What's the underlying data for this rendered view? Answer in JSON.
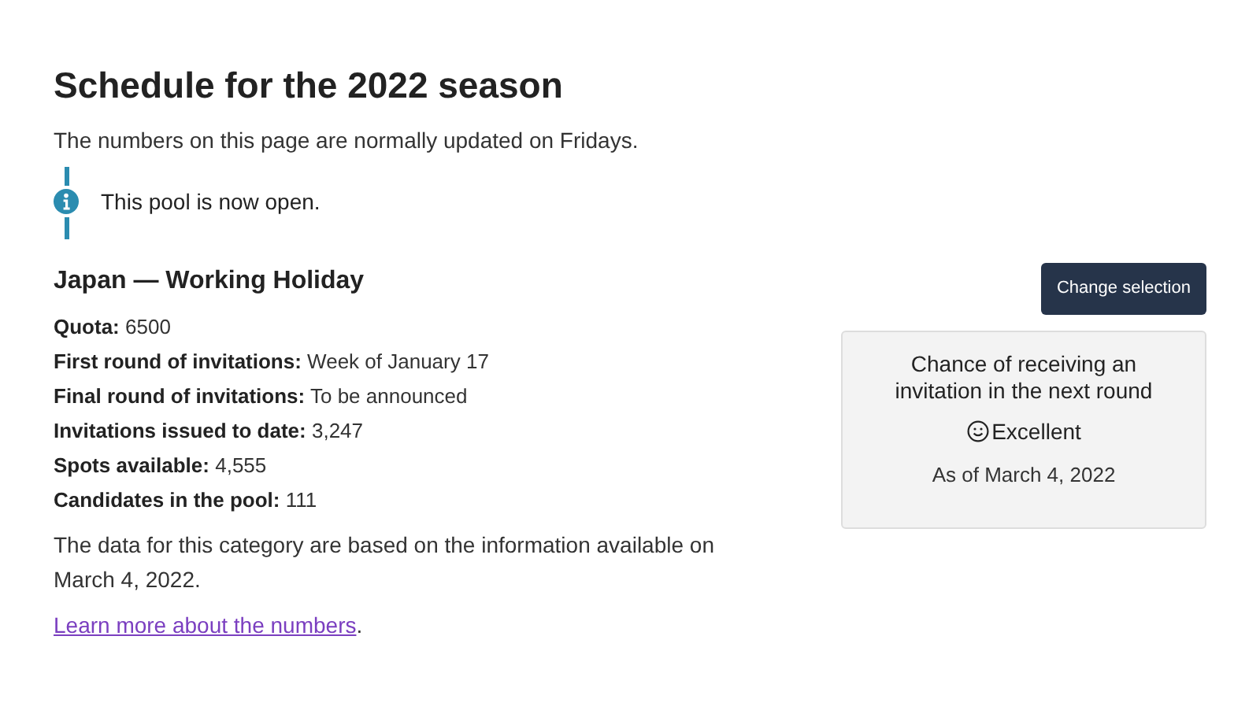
{
  "heading": "Schedule for the 2022 season",
  "intro": "The numbers on this page are normally updated on Fridays.",
  "notice": {
    "text": "This pool is now open."
  },
  "category": {
    "title": "Japan — Working Holiday"
  },
  "facts": [
    {
      "text": "**Quota:** 6500"
    },
    {
      "text": "**First round of invitations:** Week of January 17"
    },
    {
      "text": "**Final round of invitations:** To be announced"
    },
    {
      "text": "**Invitations issued to date:** 3,247"
    },
    {
      "text": "**Spots available:** 4,555"
    },
    {
      "text": "**Candidates in the pool:** 111"
    }
  ],
  "data_note": "The data for this category are based on the information available on March 4, 2022.",
  "learn_more": {
    "link": "Learn more about the numbers",
    "after": "."
  },
  "change_button": "Change selection",
  "chance_card": {
    "title": "Chance of receiving an invitation in the next round",
    "rating": "Excellent",
    "as_of": "As of March 4, 2022"
  }
}
